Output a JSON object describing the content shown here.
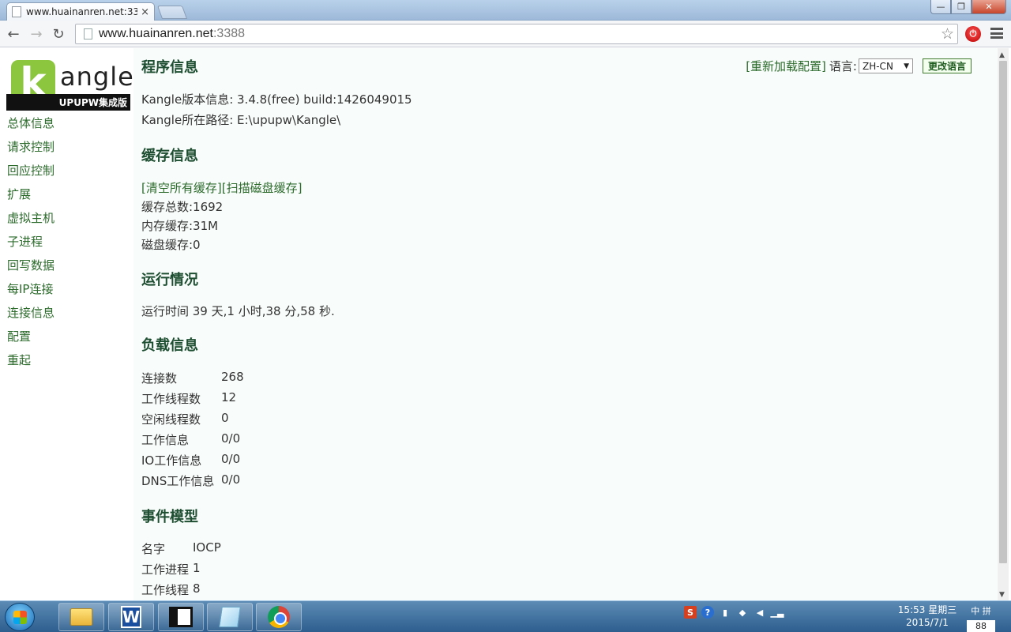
{
  "browser": {
    "tab_title": "www.huainanren.net:338",
    "tab_close": "×",
    "url_host": "www.huainanren.net",
    "url_port": ":3388",
    "back": "←",
    "forward": "→",
    "reload": "↻",
    "star": "☆"
  },
  "window": {
    "minimize": "—",
    "maximize": "❐",
    "close": "✕"
  },
  "logo": {
    "letter": "k",
    "word": "angle",
    "band": "UPUPW集成版"
  },
  "nav": {
    "items": [
      {
        "label": "总体信息"
      },
      {
        "label": "请求控制"
      },
      {
        "label": "回应控制"
      },
      {
        "label": "扩展"
      },
      {
        "label": "虚拟主机"
      },
      {
        "label": "子进程"
      },
      {
        "label": "回写数据"
      },
      {
        "label": "每IP连接"
      },
      {
        "label": "连接信息"
      },
      {
        "label": "配置"
      },
      {
        "label": "重起"
      }
    ]
  },
  "topright": {
    "reload_link": "[重新加载配置]",
    "lang_label": "语言:",
    "lang_value": "ZH-CN",
    "lang_arrow": "▼",
    "change_lang": "更改语言"
  },
  "program": {
    "heading": "程序信息",
    "version_line": "Kangle版本信息: 3.4.8(free) build:1426049015",
    "path_line": "Kangle所在路径: E:\\upupw\\Kangle\\"
  },
  "cache": {
    "heading": "缓存信息",
    "clear_link": "[清空所有缓存]",
    "scan_link": "[扫描磁盘缓存]",
    "total": "缓存总数:1692",
    "memory": "内存缓存:31M",
    "disk": "磁盘缓存:0"
  },
  "runtime": {
    "heading": "运行情况",
    "uptime": "运行时间 39 天,1 小时,38 分,58 秒."
  },
  "load": {
    "heading": "负载信息",
    "rows": [
      {
        "k": "连接数",
        "v": "268"
      },
      {
        "k": "工作线程数",
        "v": "12"
      },
      {
        "k": "空闲线程数",
        "v": "0"
      },
      {
        "k": "工作信息",
        "v": "0/0"
      },
      {
        "k": "IO工作信息",
        "v": "0/0"
      },
      {
        "k": "DNS工作信息",
        "v": "0/0"
      }
    ]
  },
  "event": {
    "heading": "事件模型",
    "rows": [
      {
        "k": "名字",
        "v": "IOCP"
      },
      {
        "k": "工作进程",
        "v": "1"
      },
      {
        "k": "工作线程",
        "v": "8"
      }
    ]
  },
  "scrollbar": {
    "up": "▲",
    "down": "▼"
  },
  "taskbar": {
    "word_letter": "W",
    "tray": {
      "s": "S",
      "q": "?"
    },
    "clock_time": "15:53 星期三",
    "clock_date": "2015/7/1",
    "ime_top": "中 拼",
    "ime_num": "88"
  }
}
